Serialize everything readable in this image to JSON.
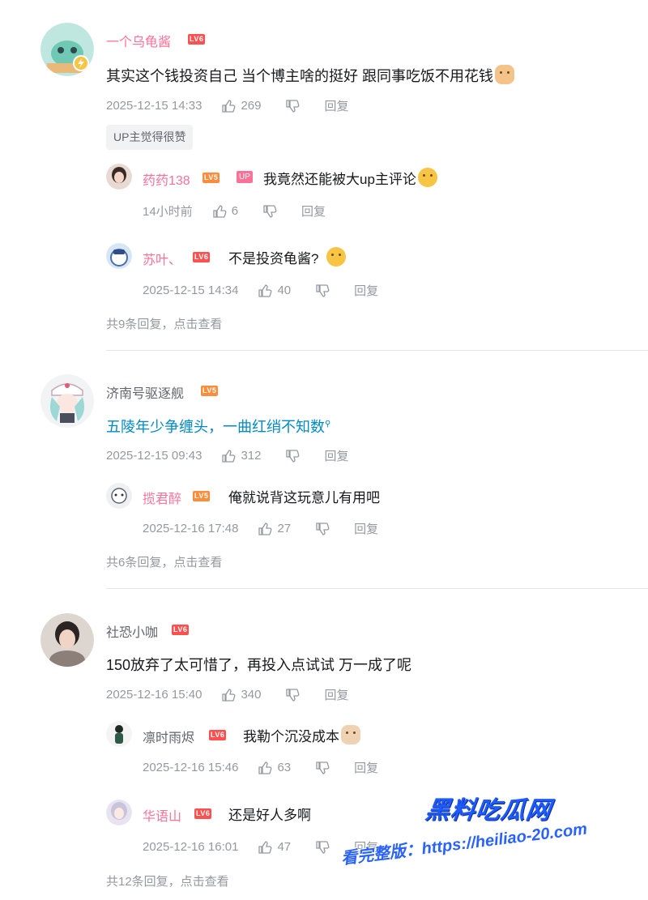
{
  "comments": [
    {
      "user": "一个乌龟酱",
      "level": "LV6",
      "text": "其实这个钱投资自己 当个博主啥的挺好 跟同事吃饭不用花钱",
      "time": "2025-12-15 14:33",
      "likes": "269",
      "reply_label": "回复",
      "up_badge": "UP主觉得很赞",
      "replies": [
        {
          "user": "药药138",
          "level": "LV5",
          "up_tag": "UP",
          "text": "我竟然还能被大up主评论",
          "time": "14小时前",
          "likes": "6",
          "reply_label": "回复"
        },
        {
          "user": "苏叶、",
          "level": "LV6",
          "text": "不是投资龟酱?",
          "time": "2025-12-15 14:34",
          "likes": "40",
          "reply_label": "回复"
        }
      ],
      "view_more": "共9条回复，点击查看"
    },
    {
      "user": "济南号驱逐舰",
      "level": "LV5",
      "text": "五陵年少争缠头，一曲红绡不知数",
      "time": "2025-12-15 09:43",
      "likes": "312",
      "reply_label": "回复",
      "replies": [
        {
          "user": "揽君醉",
          "level": "LV5",
          "text": "俺就说背这玩意儿有用吧",
          "time": "2025-12-16 17:48",
          "likes": "27",
          "reply_label": "回复"
        }
      ],
      "view_more": "共6条回复，点击查看"
    },
    {
      "user": "社恐小咖",
      "level": "LV6",
      "text": "150放弃了太可惜了，再投入点试试 万一成了呢",
      "time": "2025-12-16 15:40",
      "likes": "340",
      "reply_label": "回复",
      "replies": [
        {
          "user": "凛时雨烬",
          "level": "LV6",
          "text": "我勒个沉没成本",
          "time": "2025-12-16 15:46",
          "likes": "63",
          "reply_label": "回复"
        },
        {
          "user": "华语山",
          "level": "LV6",
          "text": "还是好人多啊",
          "time": "2025-12-16 16:01",
          "likes": "47",
          "reply_label": "回复"
        }
      ],
      "view_more": "共12条回复，点击查看"
    }
  ],
  "watermark": {
    "title": "黑料吃瓜网",
    "line": "看完整版：https://heiliao-20.com"
  },
  "colors": {
    "username_pink": "#fb7299",
    "username_gray": "#61666d",
    "text": "#18191c",
    "meta_gray": "#9499a0",
    "link_blue": "#008ac5",
    "lv6": "#ff4f4f",
    "lv5": "#ff8c3a"
  },
  "icons": [
    "like-icon",
    "dislike-icon",
    "search-superscript-icon",
    "emoji-icon"
  ]
}
